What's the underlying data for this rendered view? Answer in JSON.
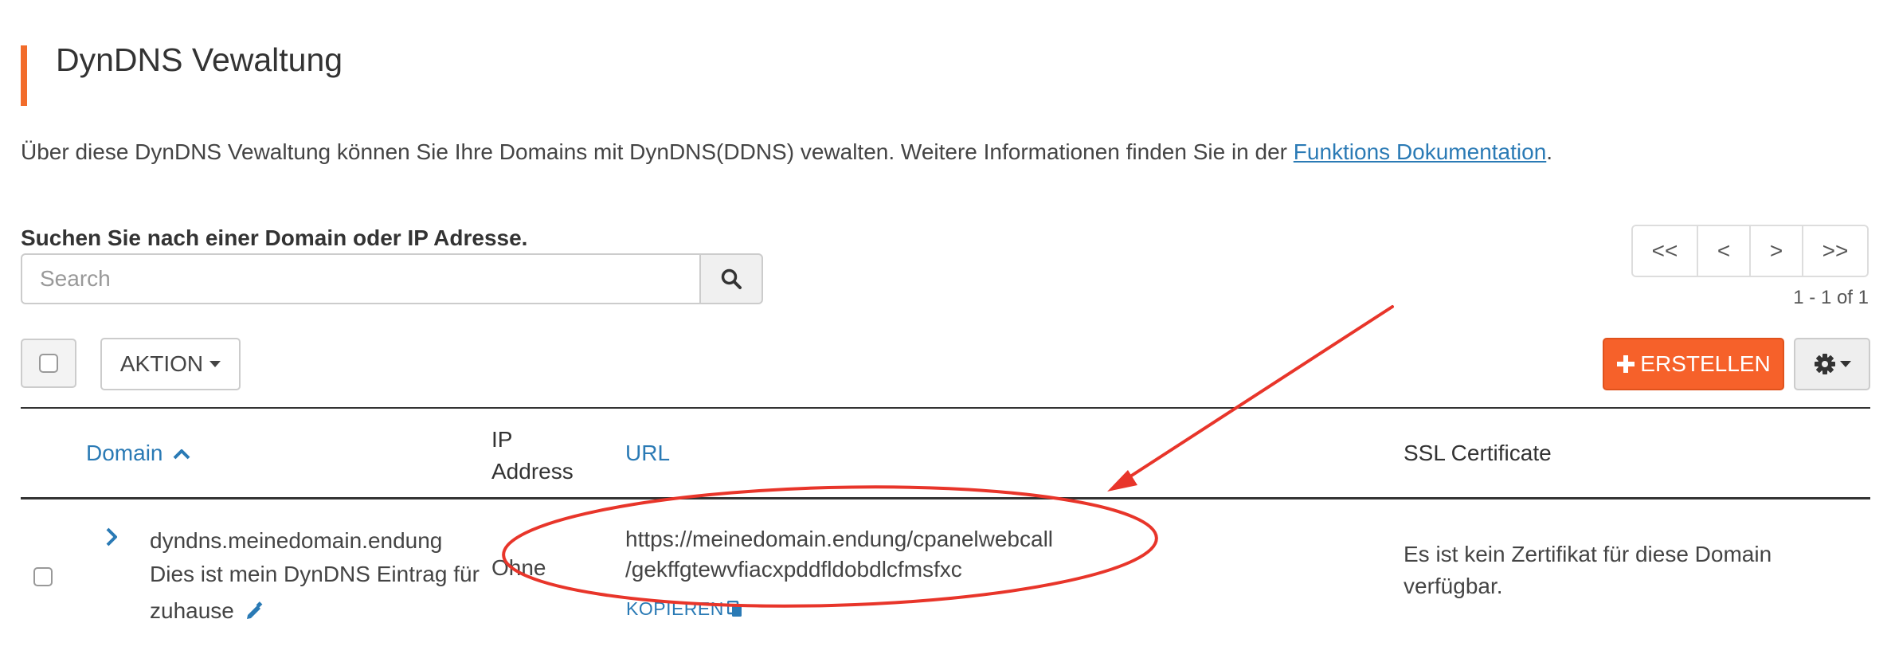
{
  "page": {
    "title": "DynDNS Vewaltung",
    "description_prefix": "Über diese DynDNS Vewaltung können Sie Ihre Domains mit DynDNS(DDNS) vewalten. Weitere Informationen finden Sie in der ",
    "description_link": "Funktions Dokumentation",
    "description_suffix": "."
  },
  "search": {
    "label": "Suchen Sie nach einer Domain oder IP Adresse.",
    "placeholder": "Search",
    "icon": "search-icon"
  },
  "pagination": {
    "first": "<<",
    "prev": "<",
    "next": ">",
    "last": ">>",
    "info": "1 - 1 of 1"
  },
  "toolbar": {
    "action_label": "AKTION",
    "create_label": "ERSTELLEN",
    "create_icon": "plus-icon",
    "settings_icon": "gear-icon"
  },
  "table": {
    "columns": {
      "domain": "Domain",
      "ip": "IP Address",
      "url": "URL",
      "ssl": "SSL Certificate"
    },
    "rows": [
      {
        "domain": "dyndns.meinedomain.endung",
        "description": "Dies ist mein DynDNS Eintrag für zuhause",
        "ip": "Ohne",
        "url_line1": "https://meinedomain.endung/cpanelwebcall",
        "url_line2": "/gekffgtewvfiacxpddfldobdlcfmsfxc",
        "copy_label": "KOPIEREN",
        "ssl": "Es ist kein Zertifikat für diese Domain verfügbar."
      }
    ]
  },
  "colors": {
    "accent": "#f6612a",
    "link": "#2a7ab5",
    "annotation": "#e8352a"
  }
}
